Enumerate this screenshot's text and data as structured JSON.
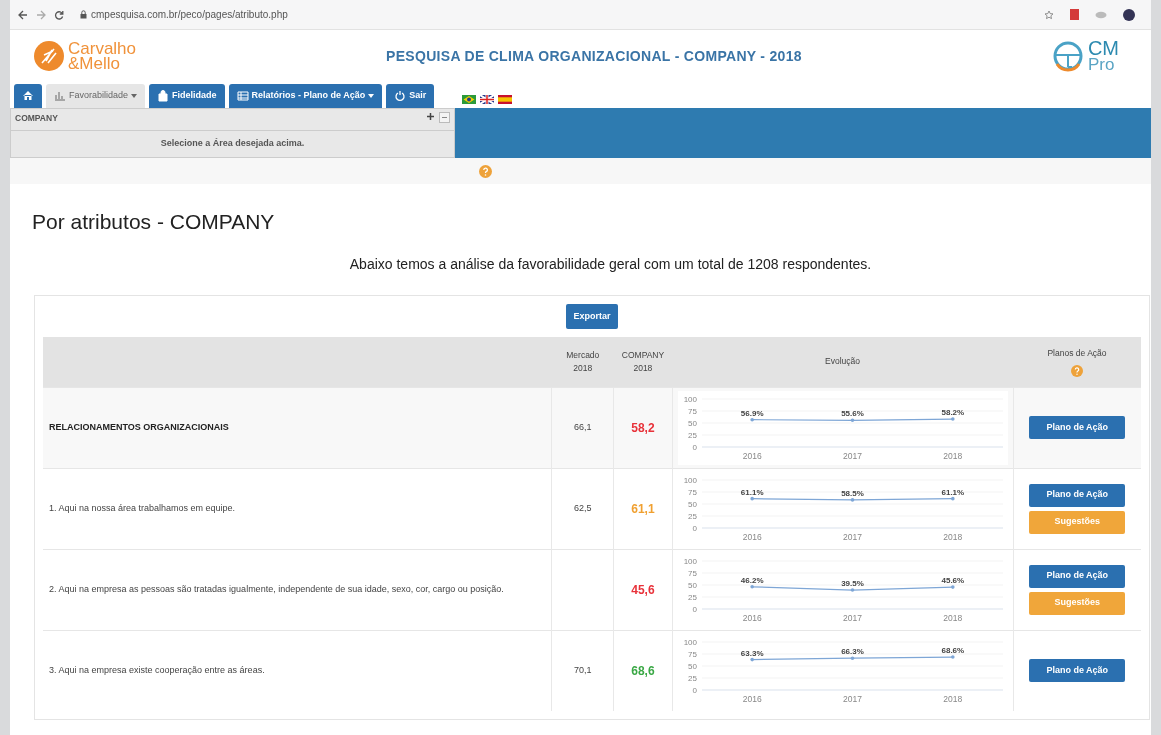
{
  "browser": {
    "url": "cmpesquisa.com.br/peco/pages/atributo.php"
  },
  "header": {
    "logo_line1": "Carvalho",
    "logo_line2": "&Mello",
    "title": "PESQUISA DE CLIMA ORGANIZACIONAL - COMPANY - 2018",
    "badge_line1": "CM",
    "badge_line2": "Pro"
  },
  "nav": {
    "tabs": [
      {
        "kind": "home",
        "selected": false
      },
      {
        "kind": "dropdown",
        "label": "Favorabilidade",
        "selected": true
      },
      {
        "kind": "link",
        "label": "Fidelidade",
        "selected": false
      },
      {
        "kind": "dropdown",
        "label": "Relatórios - Plano de Ação",
        "selected": false
      },
      {
        "kind": "link",
        "label": "Sair",
        "selected": false
      }
    ]
  },
  "area_panel": {
    "company": "COMPANY",
    "hint": "Selecione a Área desejada acima."
  },
  "page": {
    "heading": "Por atributos - COMPANY",
    "summary": "Abaixo temos a análise da favorabilidade geral com um total de 1208 respondentes."
  },
  "table": {
    "export_button": "Exportar",
    "columns": [
      "Mercado 2018",
      "COMPANY 2018",
      "Evolução",
      "Planos de Ação"
    ],
    "rows": [
      {
        "kind": "group",
        "label": "RELACIONAMENTOS ORGANIZACIONAIS",
        "mercado": "66,1",
        "company": "58,2",
        "color": "#e8323a",
        "chart_data": {
          "type": "line",
          "categories": [
            "2016",
            "2017",
            "2018"
          ],
          "series": [
            {
              "color": "#7ea6d6",
              "values": [
                56.9,
                55.6,
                58.2
              ]
            }
          ],
          "yticks": [
            0,
            25,
            50,
            75,
            100
          ],
          "ylim": [
            0,
            100
          ],
          "grid": true,
          "value_labels": [
            "56.9%",
            "55.6%",
            "58.2%"
          ]
        },
        "actions": [
          {
            "kind": "plan",
            "label": "Plano de Ação"
          }
        ]
      },
      {
        "kind": "item",
        "label": "1. Aqui na nossa área trabalhamos em equipe.",
        "mercado": "62,5",
        "company": "61,1",
        "color": "#f0a030",
        "chart_data": {
          "type": "line",
          "categories": [
            "2016",
            "2017",
            "2018"
          ],
          "series": [
            {
              "color": "#7ea6d6",
              "values": [
                61.1,
                58.5,
                61.1
              ]
            }
          ],
          "yticks": [
            0,
            25,
            50,
            75,
            100
          ],
          "ylim": [
            0,
            100
          ],
          "grid": true,
          "value_labels": [
            "61.1%",
            "58.5%",
            "61.1%"
          ]
        },
        "actions": [
          {
            "kind": "plan",
            "label": "Plano de Ação"
          },
          {
            "kind": "suggest",
            "label": "Sugestões"
          }
        ]
      },
      {
        "kind": "item",
        "label": "2. Aqui na empresa as pessoas são tratadas igualmente, independente de sua idade, sexo, cor, cargo ou posição.",
        "mercado": "",
        "company": "45,6",
        "color": "#e8323a",
        "chart_data": {
          "type": "line",
          "categories": [
            "2016",
            "2017",
            "2018"
          ],
          "series": [
            {
              "color": "#7ea6d6",
              "values": [
                46.2,
                39.5,
                45.6
              ]
            }
          ],
          "yticks": [
            0,
            25,
            50,
            75,
            100
          ],
          "ylim": [
            0,
            100
          ],
          "grid": true,
          "value_labels": [
            "46.2%",
            "39.5%",
            "45.6%"
          ]
        },
        "actions": [
          {
            "kind": "plan",
            "label": "Plano de Ação"
          },
          {
            "kind": "suggest",
            "label": "Sugestões"
          }
        ]
      },
      {
        "kind": "item",
        "label": "3. Aqui na empresa existe cooperação entre as áreas.",
        "mercado": "70,1",
        "company": "68,6",
        "color": "#3aa845",
        "chart_data": {
          "type": "line",
          "categories": [
            "2016",
            "2017",
            "2018"
          ],
          "series": [
            {
              "color": "#7ea6d6",
              "values": [
                63.3,
                66.3,
                68.6
              ]
            }
          ],
          "yticks": [
            0,
            25,
            50,
            75,
            100
          ],
          "ylim": [
            0,
            100
          ],
          "grid": true,
          "value_labels": [
            "63.3%",
            "66.3%",
            "68.6%"
          ]
        },
        "actions": [
          {
            "kind": "plan",
            "label": "Plano de Ação"
          }
        ]
      }
    ]
  }
}
